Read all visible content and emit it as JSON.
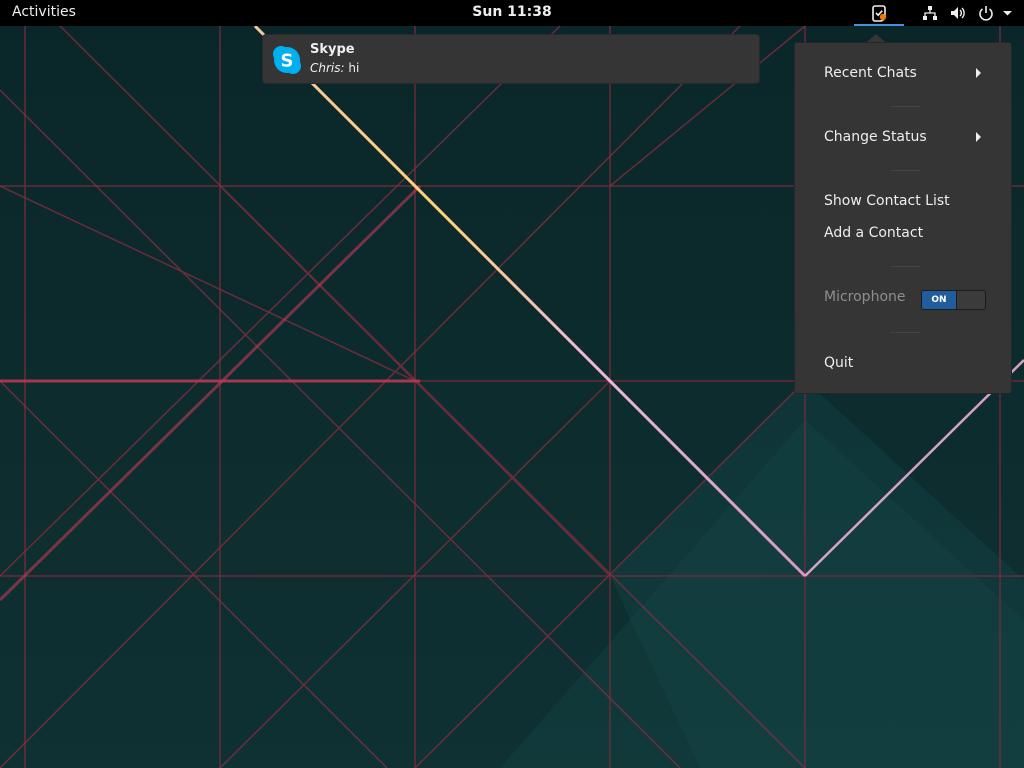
{
  "topbar": {
    "activities_label": "Activities",
    "clock": "Sun 11:38",
    "tray_icons": [
      "skype-tray-icon",
      "network-icon",
      "volume-icon",
      "power-icon",
      "system-menu-arrow-icon"
    ]
  },
  "notification": {
    "app": "Skype",
    "sender": "Chris:",
    "message": " hi",
    "icon": "skype-icon",
    "accent_color": "#00aff0"
  },
  "skype_menu": {
    "items": [
      {
        "label": "Recent Chats",
        "submenu": true
      },
      {
        "label": "Change Status",
        "submenu": true
      },
      {
        "label": "Show Contact List",
        "submenu": false
      },
      {
        "label": "Add a Contact",
        "submenu": false
      },
      {
        "label": "Microphone",
        "submenu": false,
        "disabled": true
      },
      {
        "label": "Quit",
        "submenu": false
      }
    ],
    "microphone_switch": {
      "state_label": "ON",
      "on": true,
      "color": "#215d9c"
    }
  },
  "colors": {
    "topbar_bg": "#000000",
    "popup_bg": "#353535",
    "selection_accent": "#4a90d9"
  }
}
